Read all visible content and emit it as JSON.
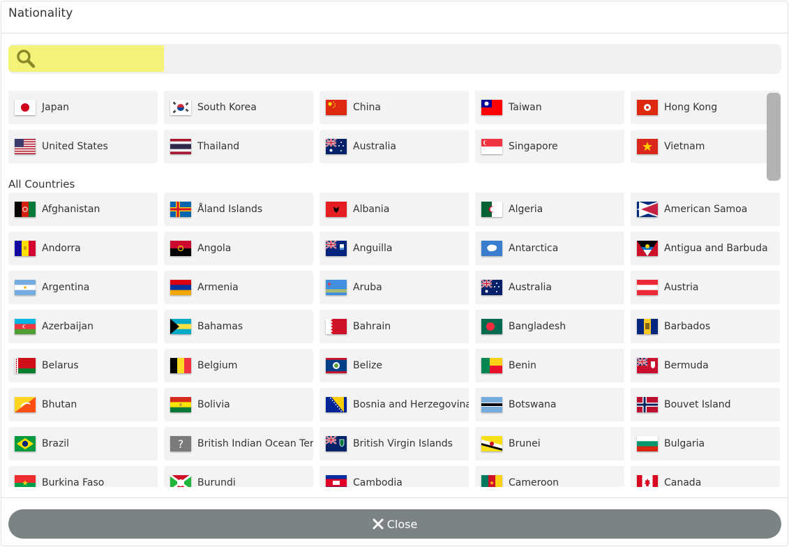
{
  "dialog": {
    "title": "Nationality"
  },
  "search": {
    "placeholder": "",
    "value": ""
  },
  "favorites": [
    {
      "label": "Japan",
      "flag": "jp"
    },
    {
      "label": "South Korea",
      "flag": "kr"
    },
    {
      "label": "China",
      "flag": "cn"
    },
    {
      "label": "Taiwan",
      "flag": "tw"
    },
    {
      "label": "Hong Kong",
      "flag": "hk"
    },
    {
      "label": "United States",
      "flag": "us"
    },
    {
      "label": "Thailand",
      "flag": "th"
    },
    {
      "label": "Australia",
      "flag": "au"
    },
    {
      "label": "Singapore",
      "flag": "sg"
    },
    {
      "label": "Vietnam",
      "flag": "vn"
    }
  ],
  "all_countries_label": "All Countries",
  "countries": [
    {
      "label": "Afghanistan",
      "flag": "af"
    },
    {
      "label": "Åland Islands",
      "flag": "ax"
    },
    {
      "label": "Albania",
      "flag": "al"
    },
    {
      "label": "Algeria",
      "flag": "dz"
    },
    {
      "label": "American Samoa",
      "flag": "as"
    },
    {
      "label": "Andorra",
      "flag": "ad"
    },
    {
      "label": "Angola",
      "flag": "ao"
    },
    {
      "label": "Anguilla",
      "flag": "ai"
    },
    {
      "label": "Antarctica",
      "flag": "aq"
    },
    {
      "label": "Antigua and Barbuda",
      "flag": "ag"
    },
    {
      "label": "Argentina",
      "flag": "ar"
    },
    {
      "label": "Armenia",
      "flag": "am"
    },
    {
      "label": "Aruba",
      "flag": "aw"
    },
    {
      "label": "Australia",
      "flag": "au"
    },
    {
      "label": "Austria",
      "flag": "at"
    },
    {
      "label": "Azerbaijan",
      "flag": "az"
    },
    {
      "label": "Bahamas",
      "flag": "bs"
    },
    {
      "label": "Bahrain",
      "flag": "bh"
    },
    {
      "label": "Bangladesh",
      "flag": "bd"
    },
    {
      "label": "Barbados",
      "flag": "bb"
    },
    {
      "label": "Belarus",
      "flag": "by"
    },
    {
      "label": "Belgium",
      "flag": "be"
    },
    {
      "label": "Belize",
      "flag": "bz"
    },
    {
      "label": "Benin",
      "flag": "bj"
    },
    {
      "label": "Bermuda",
      "flag": "bm"
    },
    {
      "label": "Bhutan",
      "flag": "bt"
    },
    {
      "label": "Bolivia",
      "flag": "bo"
    },
    {
      "label": "Bosnia and Herzegovina",
      "flag": "ba"
    },
    {
      "label": "Botswana",
      "flag": "bw"
    },
    {
      "label": "Bouvet Island",
      "flag": "bv"
    },
    {
      "label": "Brazil",
      "flag": "br"
    },
    {
      "label": "British Indian Ocean Terri",
      "flag": "unknown"
    },
    {
      "label": "British Virgin Islands",
      "flag": "vg"
    },
    {
      "label": "Brunei",
      "flag": "bn"
    },
    {
      "label": "Bulgaria",
      "flag": "bg"
    },
    {
      "label": "Burkina Faso",
      "flag": "bf"
    },
    {
      "label": "Burundi",
      "flag": "bi"
    },
    {
      "label": "Cambodia",
      "flag": "kh"
    },
    {
      "label": "Cameroon",
      "flag": "cm"
    },
    {
      "label": "Canada",
      "flag": "ca"
    }
  ],
  "close_button": {
    "label": "Close",
    "icon": "close-icon"
  },
  "colors": {
    "search_highlight": "#f4f279",
    "close_button": "#7b8385",
    "item_bg": "#f3f3f3"
  }
}
